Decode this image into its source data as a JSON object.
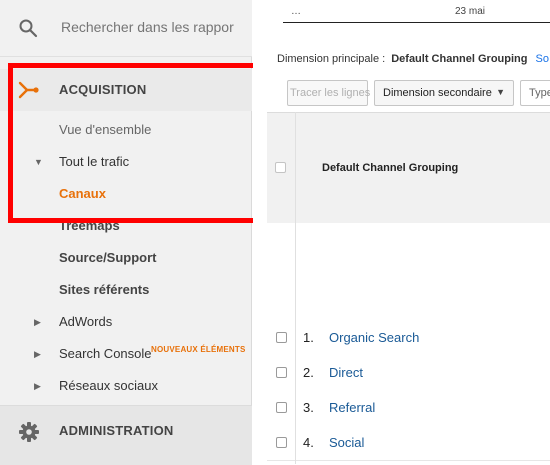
{
  "sidebar": {
    "search_placeholder": "Rechercher dans les rappor",
    "acquisition": {
      "label": "ACQUISITION",
      "items": [
        {
          "label": "Vue d'ensemble"
        },
        {
          "label": "Tout le trafic"
        },
        {
          "label": "Canaux"
        },
        {
          "label": "Treemaps"
        },
        {
          "label": "Source/Support"
        },
        {
          "label": "Sites référents"
        },
        {
          "label": "AdWords"
        },
        {
          "label": "Search Console",
          "badge": "NOUVEAUX ÉLÉMENTS"
        },
        {
          "label": "Réseaux sociaux"
        }
      ]
    },
    "administration": {
      "label": "ADMINISTRATION"
    }
  },
  "chart_strip": {
    "ellipsis": "…",
    "date_label": "23 mai"
  },
  "main": {
    "primary_dimension_label": "Dimension principale :",
    "primary_dimension_value": "Default Channel Grouping",
    "more_link": "So",
    "plot_rows_button": "Tracer les lignes",
    "secondary_dimension_button": "Dimension secondaire",
    "type_label": "Type d",
    "table": {
      "column_header": "Default Channel Grouping",
      "rows": [
        {
          "index": "1.",
          "name": "Organic Search"
        },
        {
          "index": "2.",
          "name": "Direct"
        },
        {
          "index": "3.",
          "name": "Referral"
        },
        {
          "index": "4.",
          "name": "Social"
        }
      ]
    }
  },
  "colors": {
    "accent_orange": "#e8710a",
    "highlight_red": "#ff0000",
    "link_blue": "#1a5a96"
  },
  "icons": {
    "search": "search-icon",
    "acquisition": "acquisition-icon",
    "administration": "gear-icon"
  }
}
